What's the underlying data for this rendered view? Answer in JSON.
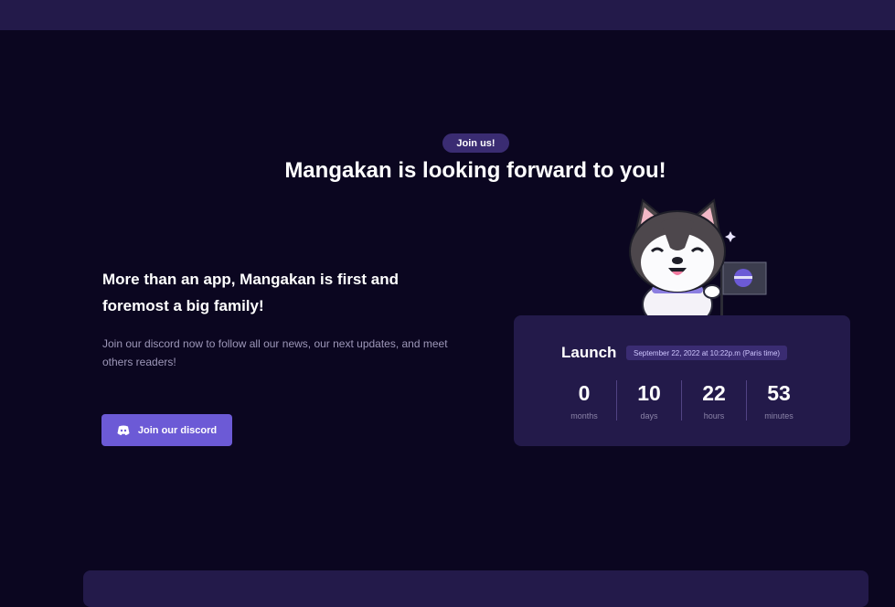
{
  "hero": {
    "badge": "Join us!",
    "title": "Mangakan is looking forward to you!"
  },
  "intro": {
    "lead": "More than an app, Mangakan is first and foremost a big family!",
    "description": "Join our discord now to follow all our news, our next updates, and meet others readers!",
    "button_label": "Join our discord",
    "button_icon": "discord-icon"
  },
  "launch": {
    "title": "Launch",
    "date": "September 22, 2022 at 10:22p.m (Paris time)",
    "countdown": [
      {
        "value": "0",
        "unit": "months"
      },
      {
        "value": "10",
        "unit": "days"
      },
      {
        "value": "22",
        "unit": "hours"
      },
      {
        "value": "53",
        "unit": "minutes"
      }
    ],
    "mascot": "husky-mascot-with-flag"
  },
  "colors": {
    "background": "#0b0620",
    "panel": "#231a4a",
    "accent": "#6c5ad6",
    "badge": "#3a2c72"
  }
}
